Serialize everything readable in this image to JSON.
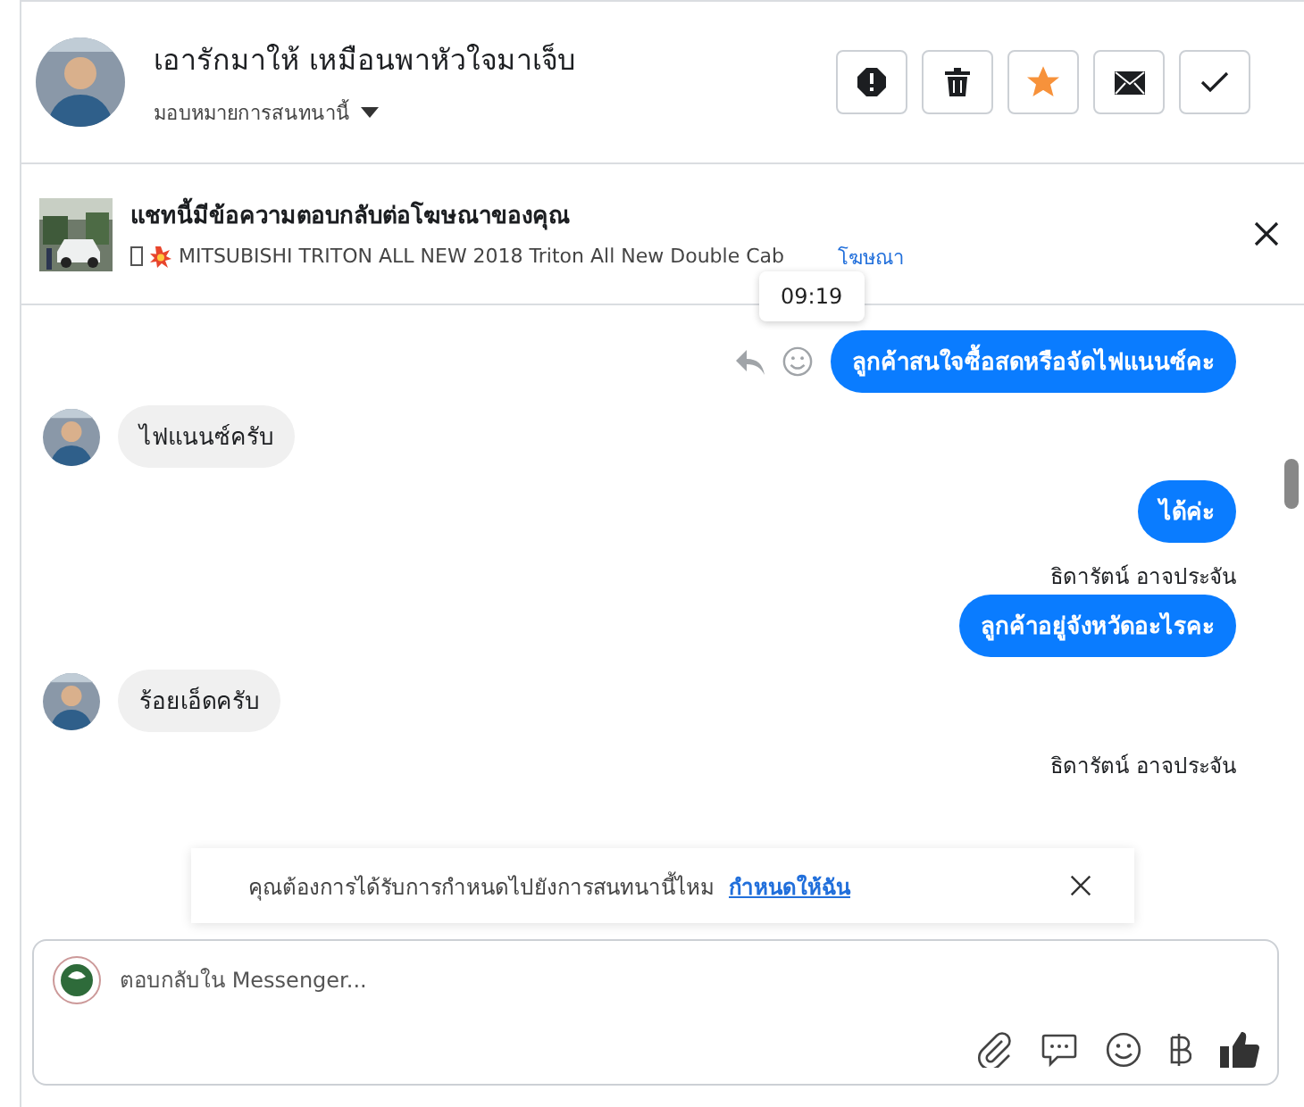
{
  "header": {
    "title": "เอารักมาให้ เหมือนพาหัวใจมาเจ็บ",
    "assign": "มอบหมายการสนทนานี้",
    "actions": [
      {
        "kind": "spam"
      },
      {
        "kind": "delete"
      },
      {
        "kind": "star"
      },
      {
        "kind": "unread"
      },
      {
        "kind": "done"
      }
    ]
  },
  "ad": {
    "title": "แชทนี้มีข้อความตอบกลับต่อโฆษณาของคุณ",
    "subtitle": "MITSUBISHI TRITON ALL NEW 2018 Triton All New Double Cab",
    "link": "โฆษณา",
    "tooltip": "09:19"
  },
  "messages": [
    {
      "kind": "outgoing",
      "text": "ลูกค้าสนใจซื้อสดหรือจัดไฟแนนซ์คะ",
      "actions": true
    },
    {
      "kind": "incoming",
      "text": "ไฟแนนซ์ครับ"
    },
    {
      "kind": "outgoing",
      "text": "ได้ค่ะ",
      "actions": false
    },
    {
      "kind": "sender",
      "text": "ธิดารัตน์ อาจประจัน"
    },
    {
      "kind": "outgoing",
      "text": "ลูกค้าอยู่จังหวัดอะไรคะ",
      "actions": false
    },
    {
      "kind": "incoming",
      "text": "ร้อยเอ็ดครับ"
    },
    {
      "kind": "sender",
      "text": "ธิดารัตน์ อาจประจัน"
    }
  ],
  "banner": {
    "text": "คุณต้องการได้รับการกำหนดไปยังการสนทนานี้ไหม",
    "link": "กำหนดให้ฉัน"
  },
  "composer": {
    "placeholder": "ตอบกลับใน Messenger..."
  }
}
